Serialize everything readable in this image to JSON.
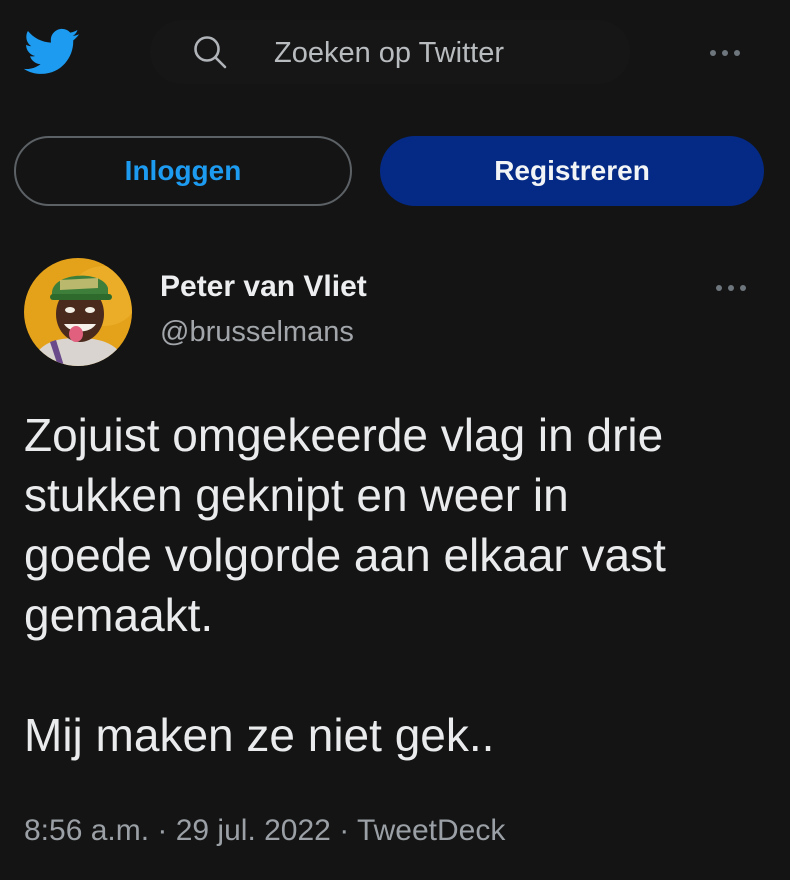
{
  "header": {
    "logo_icon": "twitter-bird-icon",
    "search": {
      "icon": "search-icon",
      "placeholder": "Zoeken op Twitter"
    },
    "more_icon": "more-horizontal-icon"
  },
  "auth": {
    "login_label": "Inloggen",
    "register_label": "Registreren"
  },
  "tweet": {
    "author": {
      "name": "Peter van Vliet",
      "handle": "@brusselmans",
      "avatar": "profile-photo"
    },
    "more_icon": "more-horizontal-icon",
    "text": "Zojuist omgekeerde vlag in drie\nstukken geknipt en weer in\ngoede volgorde aan elkaar vast\ngemaakt.\n\nMij maken ze niet gek..",
    "meta": "8:56 a.m. · 29 jul. 2022 · TweetDeck"
  },
  "colors": {
    "background": "#141414",
    "accent": "#1d9bf0",
    "register_button": "#042a85"
  }
}
